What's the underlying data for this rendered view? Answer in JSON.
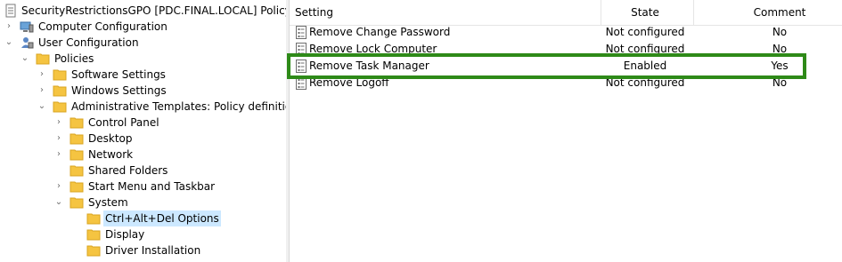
{
  "tree": {
    "root_label": "SecurityRestrictionsGPO [PDC.FINAL.LOCAL] Policy",
    "computer_configuration": "Computer Configuration",
    "user_configuration": "User Configuration",
    "policies": "Policies",
    "software_settings": "Software Settings",
    "windows_settings": "Windows Settings",
    "administrative_templates": "Administrative Templates: Policy definitions (",
    "control_panel": "Control Panel",
    "desktop": "Desktop",
    "network": "Network",
    "shared_folders": "Shared Folders",
    "start_menu": "Start Menu and Taskbar",
    "system": "System",
    "ctrl_alt_del": "Ctrl+Alt+Del Options",
    "display": "Display",
    "driver_installation": "Driver Installation",
    "selected": "Ctrl+Alt+Del Options"
  },
  "list": {
    "headers": {
      "setting": "Setting",
      "state": "State",
      "comment": "Comment"
    },
    "rows": [
      {
        "setting": "Remove Change Password",
        "state": "Not configured",
        "comment": "No"
      },
      {
        "setting": "Remove Lock Computer",
        "state": "Not configured",
        "comment": "No"
      },
      {
        "setting": "Remove Task Manager",
        "state": "Enabled",
        "comment": "Yes"
      },
      {
        "setting": "Remove Logoff",
        "state": "Not configured",
        "comment": "No"
      }
    ]
  },
  "colors": {
    "highlight_border": "#2e8a18",
    "selection": "#cce8ff",
    "folder": "#f5c441"
  }
}
